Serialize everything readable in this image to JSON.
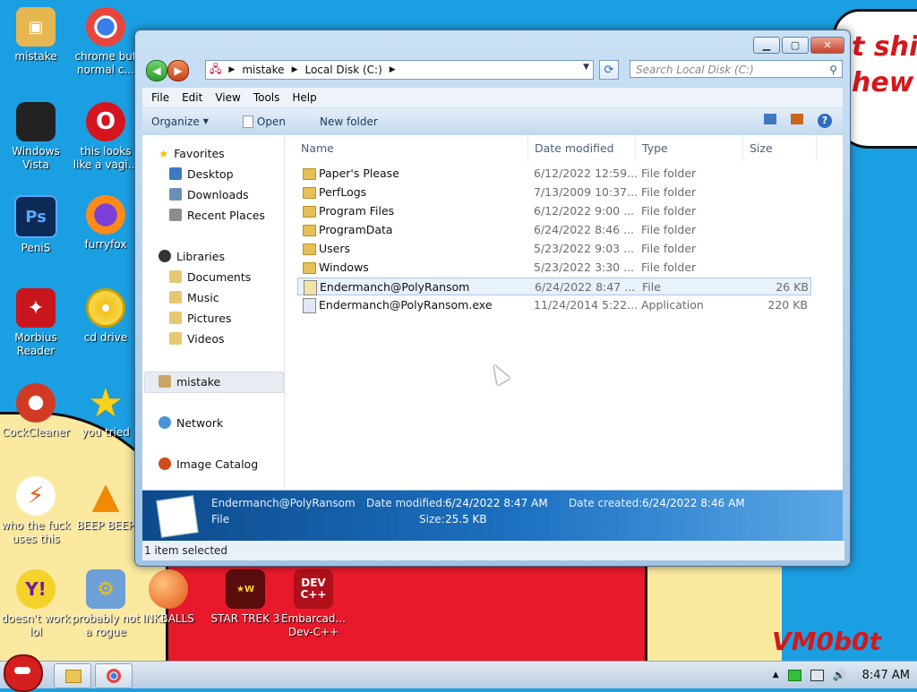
{
  "desktop": {
    "icons": [
      {
        "label": "mistake"
      },
      {
        "label": "chrome but normal c..."
      },
      {
        "label": "Windows Vista"
      },
      {
        "label": "this looks like a vagi..."
      },
      {
        "label": "PeniS"
      },
      {
        "label": "furryfox"
      },
      {
        "label": "Morbius Reader"
      },
      {
        "label": "cd drive"
      },
      {
        "label": "CockCleaner"
      },
      {
        "label": "you tried"
      },
      {
        "label": "who the fuck uses this"
      },
      {
        "label": "BEEP BEEP"
      },
      {
        "label": "doesn't work lol"
      },
      {
        "label": "probably not a rogue"
      },
      {
        "label": "INKBALLS"
      },
      {
        "label": "STAR TREK 3"
      },
      {
        "label": "Embarcad... Dev-C++"
      }
    ],
    "wallpaper_text": {
      "bubble_line1": "t shit",
      "bubble_line2": "hew",
      "signature": "VM0b0t"
    }
  },
  "explorer": {
    "breadcrumb": [
      "mistake",
      "Local Disk (C:)"
    ],
    "search_placeholder": "Search Local Disk (C:)",
    "menu": [
      "File",
      "Edit",
      "View",
      "Tools",
      "Help"
    ],
    "toolbar": {
      "organize": "Organize",
      "open": "Open",
      "new_folder": "New folder"
    },
    "nav": {
      "favorites": "Favorites",
      "desktop": "Desktop",
      "downloads": "Downloads",
      "recent": "Recent Places",
      "libraries": "Libraries",
      "documents": "Documents",
      "music": "Music",
      "pictures": "Pictures",
      "videos": "Videos",
      "mistake": "mistake",
      "network": "Network",
      "image_catalog": "Image Catalog"
    },
    "columns": {
      "name": "Name",
      "date": "Date modified",
      "type": "Type",
      "size": "Size"
    },
    "files": [
      {
        "name": "Paper's Please",
        "date": "6/12/2022 12:59...",
        "type": "File folder",
        "size": ""
      },
      {
        "name": "PerfLogs",
        "date": "7/13/2009 10:37...",
        "type": "File folder",
        "size": ""
      },
      {
        "name": "Program Files",
        "date": "6/12/2022 9:00 ...",
        "type": "File folder",
        "size": ""
      },
      {
        "name": "ProgramData",
        "date": "6/24/2022 8:46 ...",
        "type": "File folder",
        "size": ""
      },
      {
        "name": "Users",
        "date": "5/23/2022 9:03 ...",
        "type": "File folder",
        "size": ""
      },
      {
        "name": "Windows",
        "date": "5/23/2022 3:30 ...",
        "type": "File folder",
        "size": ""
      },
      {
        "name": "Endermanch@PolyRansom",
        "date": "6/24/2022 8:47 ...",
        "type": "File",
        "size": "26 KB"
      },
      {
        "name": "Endermanch@PolyRansom.exe",
        "date": "11/24/2014 5:22...",
        "type": "Application",
        "size": "220 KB"
      }
    ],
    "details": {
      "name": "Endermanch@PolyRansom",
      "type": "File",
      "date_modified_label": "Date modified:",
      "date_modified": "6/24/2022 8:47 AM",
      "size_label": "Size:",
      "size": "25.5 KB",
      "date_created_label": "Date created:",
      "date_created": "6/24/2022 8:46 AM"
    },
    "status": "1 item selected"
  },
  "taskbar": {
    "clock": "8:47 AM"
  }
}
